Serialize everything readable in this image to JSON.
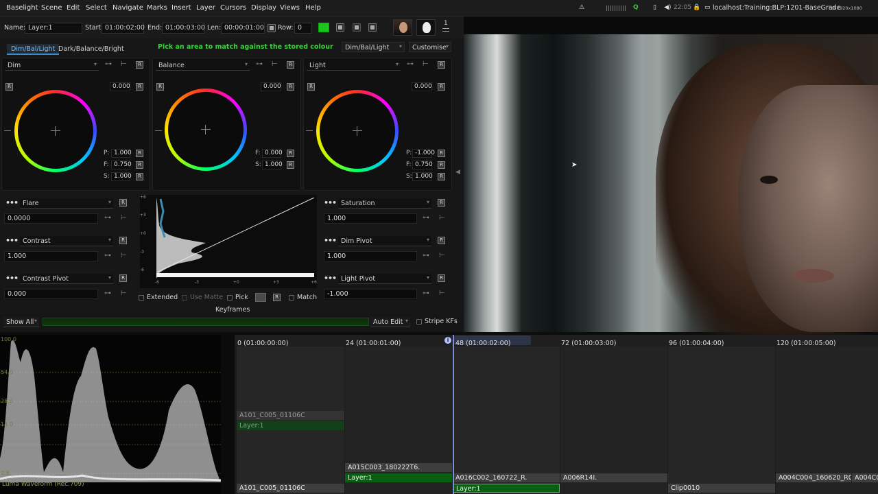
{
  "menu": [
    "Baselight",
    "Scene",
    "Edit",
    "Select",
    "Navigate",
    "Marks",
    "Insert",
    "Layer",
    "Cursors",
    "Display",
    "Views",
    "Help"
  ],
  "system": {
    "clock": "22:05",
    "host": "localhost:Training:BLP:1201-BaseGrade",
    "format": "HD 1920x1080"
  },
  "layer": {
    "name_label": "Name:",
    "name_value": "Layer:1",
    "start_label": "Start:",
    "start_value": "01:00:02:00",
    "end_label": "End:",
    "end_value": "01:00:03:00",
    "len_label": "Len:",
    "len_value": "00:00:01:00",
    "row_label": "Row:",
    "row_value": "0",
    "counter": "1"
  },
  "tabs": {
    "active": "Dim/Bal/Light",
    "other": "Dark/Balance/Bright"
  },
  "hint": "Pick an area to match against the stored colour",
  "preset_select": "Dim/Bal/Light",
  "customise": "Customise",
  "wheels": [
    {
      "name": "Dim",
      "value": "0.000",
      "p_label": "P:",
      "p": "1.000",
      "f_label": "F:",
      "f": "0.750",
      "s_label": "S:",
      "s": "1.000"
    },
    {
      "name": "Balance",
      "value": "0.000",
      "p_label": "F:",
      "p": "0.000",
      "f_label": "S:",
      "f": "1.000"
    },
    {
      "name": "Light",
      "value": "0.000",
      "p_label": "P:",
      "p": "-1.000",
      "f_label": "F:",
      "f": "0.750",
      "s_label": "S:",
      "s": "1.000"
    }
  ],
  "left_params": [
    {
      "name": "Flare",
      "value": "0.0000"
    },
    {
      "name": "Contrast",
      "value": "1.000"
    },
    {
      "name": "Contrast Pivot",
      "value": "0.000"
    }
  ],
  "right_params": [
    {
      "name": "Saturation",
      "value": "1.000"
    },
    {
      "name": "Dim Pivot",
      "value": "1.000"
    },
    {
      "name": "Light Pivot",
      "value": "-1.000"
    }
  ],
  "curve": {
    "y_ticks": [
      "+6",
      "+3",
      "+0",
      "-3",
      "-6"
    ],
    "x_ticks": [
      "-6",
      "-3",
      "+0",
      "+3",
      "+6"
    ]
  },
  "curve_controls": {
    "extended": "Extended",
    "use_matte": "Use Matte",
    "pick": "Pick",
    "match": "Match"
  },
  "keyframes": {
    "title": "Keyframes",
    "show_all": "Show All",
    "auto_edit": "Auto Edit",
    "stripe": "Stripe KFs"
  },
  "scope": {
    "label": "Luma Waveform (Rec.709)",
    "ticks": [
      "100.0",
      "54.0",
      "28.0",
      "14.0",
      "0.8"
    ]
  },
  "timeline": {
    "ticks": [
      "0 (01:00:00:00)",
      "24 (01:00:01:00)",
      "48 (01:00:02:00)",
      "72 (01:00:03:00)",
      "96 (01:00:04:00)",
      "120 (01:00:05:00)"
    ],
    "clips": {
      "c1": "A101_C005_01106C",
      "c1_layer": "Layer:1",
      "c1_bottom": "A101_C005_01106C",
      "c2": "A015C003_180222T6.",
      "c2_layer": "Layer:1",
      "c3": "A016C002_160722_R.",
      "c3_layer": "Layer:1",
      "c4": "A006R14I.",
      "c5": "Clip0010",
      "c6": "A004C004_160620_R0",
      "c7": "A004C0"
    }
  },
  "colors": {
    "accent_green": "#1ec21e",
    "hint_green": "#3bd33b",
    "clip_green": "#0a5f12"
  }
}
